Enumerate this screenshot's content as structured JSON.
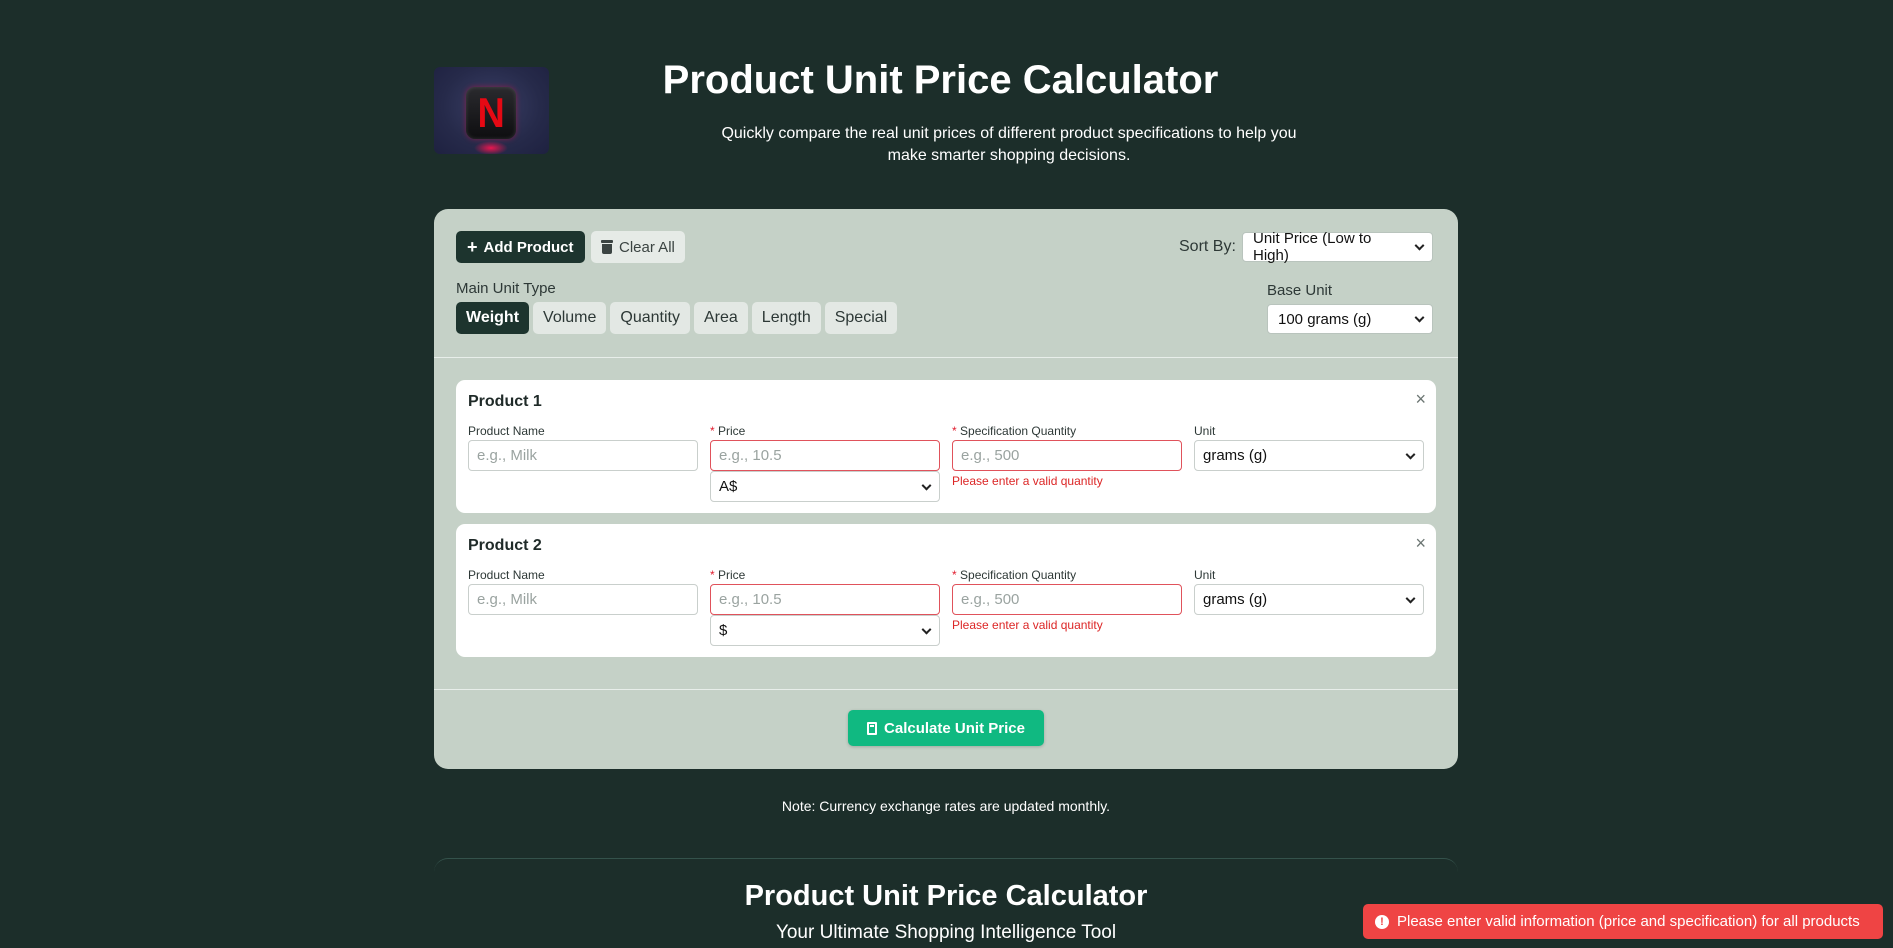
{
  "header": {
    "title": "Product Unit Price Calculator",
    "subtitle": "Quickly compare the real unit prices of different product specifications to help you make smarter shopping decisions."
  },
  "toolbar": {
    "add_label": "Add Product",
    "clear_label": "Clear All",
    "sort_label": "Sort By:",
    "sort_value": "Unit Price (Low to High)"
  },
  "unit_type": {
    "label": "Main Unit Type",
    "tabs": [
      "Weight",
      "Volume",
      "Quantity",
      "Area",
      "Length",
      "Special"
    ],
    "active": "Weight"
  },
  "base_unit": {
    "label": "Base Unit",
    "value": "100 grams (g)"
  },
  "products": [
    {
      "title": "Product 1",
      "name_label": "Product Name",
      "name_placeholder": "e.g., Milk",
      "price_label": "Price",
      "price_placeholder": "e.g., 10.5",
      "currency": "A$",
      "qty_label": "Specification Quantity",
      "qty_placeholder": "e.g., 500",
      "qty_error": "Please enter a valid quantity",
      "unit_label": "Unit",
      "unit_value": "grams (g)"
    },
    {
      "title": "Product 2",
      "name_label": "Product Name",
      "name_placeholder": "e.g., Milk",
      "price_label": "Price",
      "price_placeholder": "e.g., 10.5",
      "currency": "$",
      "qty_label": "Specification Quantity",
      "qty_placeholder": "e.g., 500",
      "qty_error": "Please enter a valid quantity",
      "unit_label": "Unit",
      "unit_value": "grams (g)"
    }
  ],
  "calculate_label": "Calculate Unit Price",
  "note": "Note: Currency exchange rates are updated monthly.",
  "bottom": {
    "title": "Product Unit Price Calculator",
    "subtitle": "Your Ultimate Shopping Intelligence Tool"
  },
  "toast": {
    "message": "Please enter valid information (price and specification) for all products"
  },
  "colors": {
    "background": "#1c2e2a",
    "card": "#c5d1c7",
    "primary": "#1d342e",
    "accent": "#10b981",
    "error": "#ef4444"
  }
}
